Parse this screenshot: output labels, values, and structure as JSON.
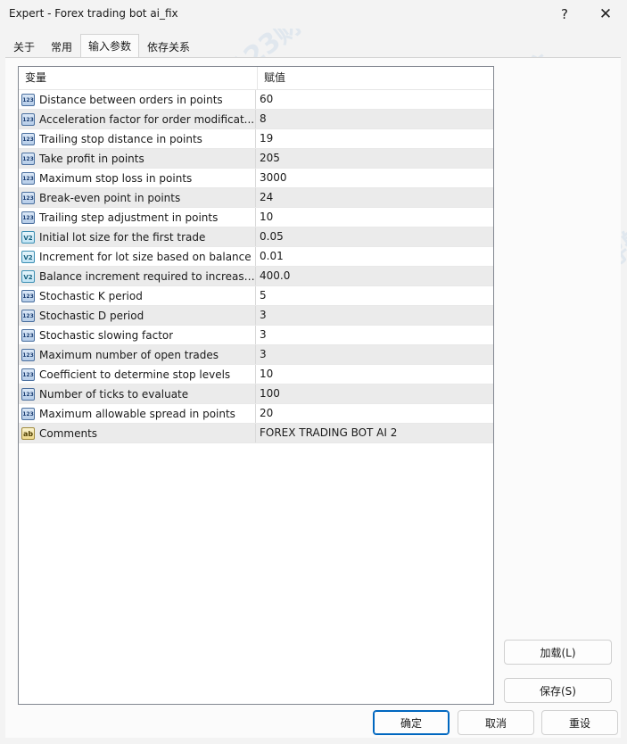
{
  "window": {
    "title": "Expert - Forex trading bot ai_fix",
    "help_glyph": "?",
    "close_glyph": "✕"
  },
  "tabs": [
    {
      "label": "关于"
    },
    {
      "label": "常用"
    },
    {
      "label": "输入参数",
      "active": true
    },
    {
      "label": "依存关系"
    }
  ],
  "grid": {
    "col_variable": "变量",
    "col_value": "赋值",
    "rows": [
      {
        "type": "int",
        "icon_text": "123",
        "name": "Distance between orders in points",
        "value": "60"
      },
      {
        "type": "int",
        "icon_text": "123",
        "name": "Acceleration factor for order modificat...",
        "value": "8"
      },
      {
        "type": "int",
        "icon_text": "123",
        "name": "Trailing stop distance in points",
        "value": "19"
      },
      {
        "type": "int",
        "icon_text": "123",
        "name": "Take profit in points",
        "value": "205"
      },
      {
        "type": "int",
        "icon_text": "123",
        "name": "Maximum stop loss in points",
        "value": "3000"
      },
      {
        "type": "int",
        "icon_text": "123",
        "name": "Break-even point in points",
        "value": "24"
      },
      {
        "type": "int",
        "icon_text": "123",
        "name": "Trailing step adjustment in points",
        "value": "10"
      },
      {
        "type": "double",
        "icon_text": "V2",
        "name": "Initial lot size for the first trade",
        "value": "0.05"
      },
      {
        "type": "double",
        "icon_text": "V2",
        "name": "Increment for lot size based on balance",
        "value": "0.01"
      },
      {
        "type": "double",
        "icon_text": "V2",
        "name": "Balance increment required to increase ...",
        "value": "400.0"
      },
      {
        "type": "int",
        "icon_text": "123",
        "name": "Stochastic K period",
        "value": "5"
      },
      {
        "type": "int",
        "icon_text": "123",
        "name": "Stochastic D period",
        "value": "3"
      },
      {
        "type": "int",
        "icon_text": "123",
        "name": "Stochastic slowing factor",
        "value": "3"
      },
      {
        "type": "int",
        "icon_text": "123",
        "name": "Maximum number of open trades",
        "value": "3"
      },
      {
        "type": "int",
        "icon_text": "123",
        "name": "Coefficient to determine stop levels",
        "value": "10"
      },
      {
        "type": "int",
        "icon_text": "123",
        "name": "Number of ticks to evaluate",
        "value": "100"
      },
      {
        "type": "int",
        "icon_text": "123",
        "name": "Maximum allowable spread in points",
        "value": "20"
      },
      {
        "type": "string",
        "icon_text": "ab",
        "name": "Comments",
        "value": "FOREX TRADING BOT AI 2"
      }
    ]
  },
  "buttons": {
    "load": "加载(L)",
    "save": "保存(S)",
    "ok": "确定",
    "cancel": "取消",
    "reset": "重设"
  },
  "watermark": "123财经导航",
  "colors": {
    "accent": "#0067c0",
    "row_alt": "#ebebeb",
    "background": "#f3f3f3"
  }
}
